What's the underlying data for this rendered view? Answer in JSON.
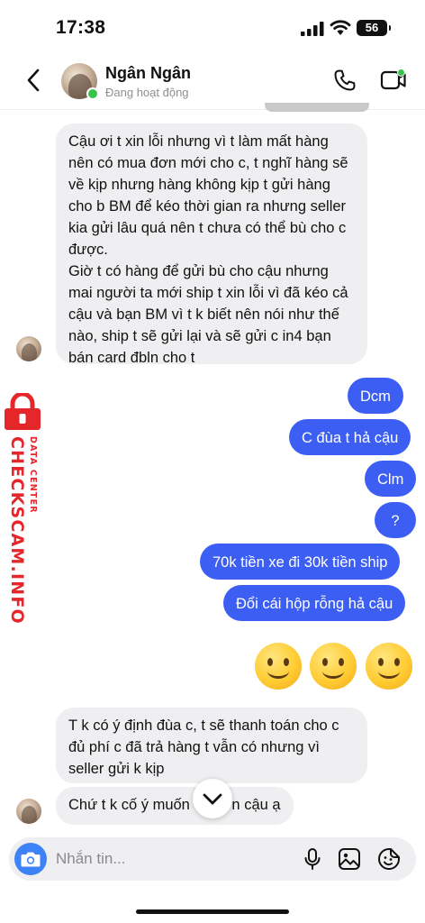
{
  "status_bar": {
    "time": "17:38",
    "battery_level": "56"
  },
  "header": {
    "contact_name": "Ngân Ngân",
    "contact_status": "Đang hoạt động",
    "icons": [
      "back-icon",
      "phone-icon",
      "video-call-icon"
    ]
  },
  "messages": [
    {
      "direction": "incoming",
      "text": "Cậu ơi t xin lỗi nhưng vì t làm mất hàng nên có mua đơn mới cho c, t nghĩ hàng sẽ về kịp nhưng hàng không kịp t gửi hàng cho b BM để kéo thời gian ra nhưng seller kia gửi lâu quá nên t chưa có thể bù cho c được.\nGiờ t có hàng để gửi bù cho cậu nhưng mai người ta mới ship t xin lỗi vì đã kéo cả cậu và bạn BM vì t k biết nên nói như thế nào, ship t sẽ gửi lại và sẽ gửi c in4 bạn bán card đbln cho t"
    },
    {
      "direction": "outgoing",
      "text": "Dcm"
    },
    {
      "direction": "outgoing",
      "text": "C đùa t hả cậu"
    },
    {
      "direction": "outgoing",
      "text": "Clm"
    },
    {
      "direction": "outgoing",
      "text": "?"
    },
    {
      "direction": "outgoing",
      "text": "70k tiền xe đi 30k tiền ship"
    },
    {
      "direction": "outgoing",
      "text": "Đổi cái hộp rỗng hả cậu"
    },
    {
      "direction": "outgoing",
      "emoji": [
        "slightly-smiling-face",
        "slightly-smiling-face",
        "slightly-smiling-face"
      ]
    },
    {
      "direction": "incoming",
      "text": "T k có ý định đùa c, t sẽ thanh toán cho c đủ phí c đã trả hàng t vẫn có nhưng vì seller gửi k kịp"
    },
    {
      "direction": "incoming",
      "text": "Chứ t k cố ý muốn   y đơn cậu ạ"
    }
  ],
  "watermark": {
    "brand": "CHECKSCAM.INFO",
    "tagline": "DATA CENTER",
    "color": "#e5262b"
  },
  "composer": {
    "placeholder": "Nhắn tin...",
    "icons": [
      "camera-icon",
      "microphone-icon",
      "gallery-icon",
      "sticker-icon"
    ]
  },
  "colors": {
    "outgoing_bubble": "#3d5ef3",
    "incoming_bubble": "#efeff1",
    "online": "#3ac34a",
    "camera_button": "#3d82f6"
  }
}
